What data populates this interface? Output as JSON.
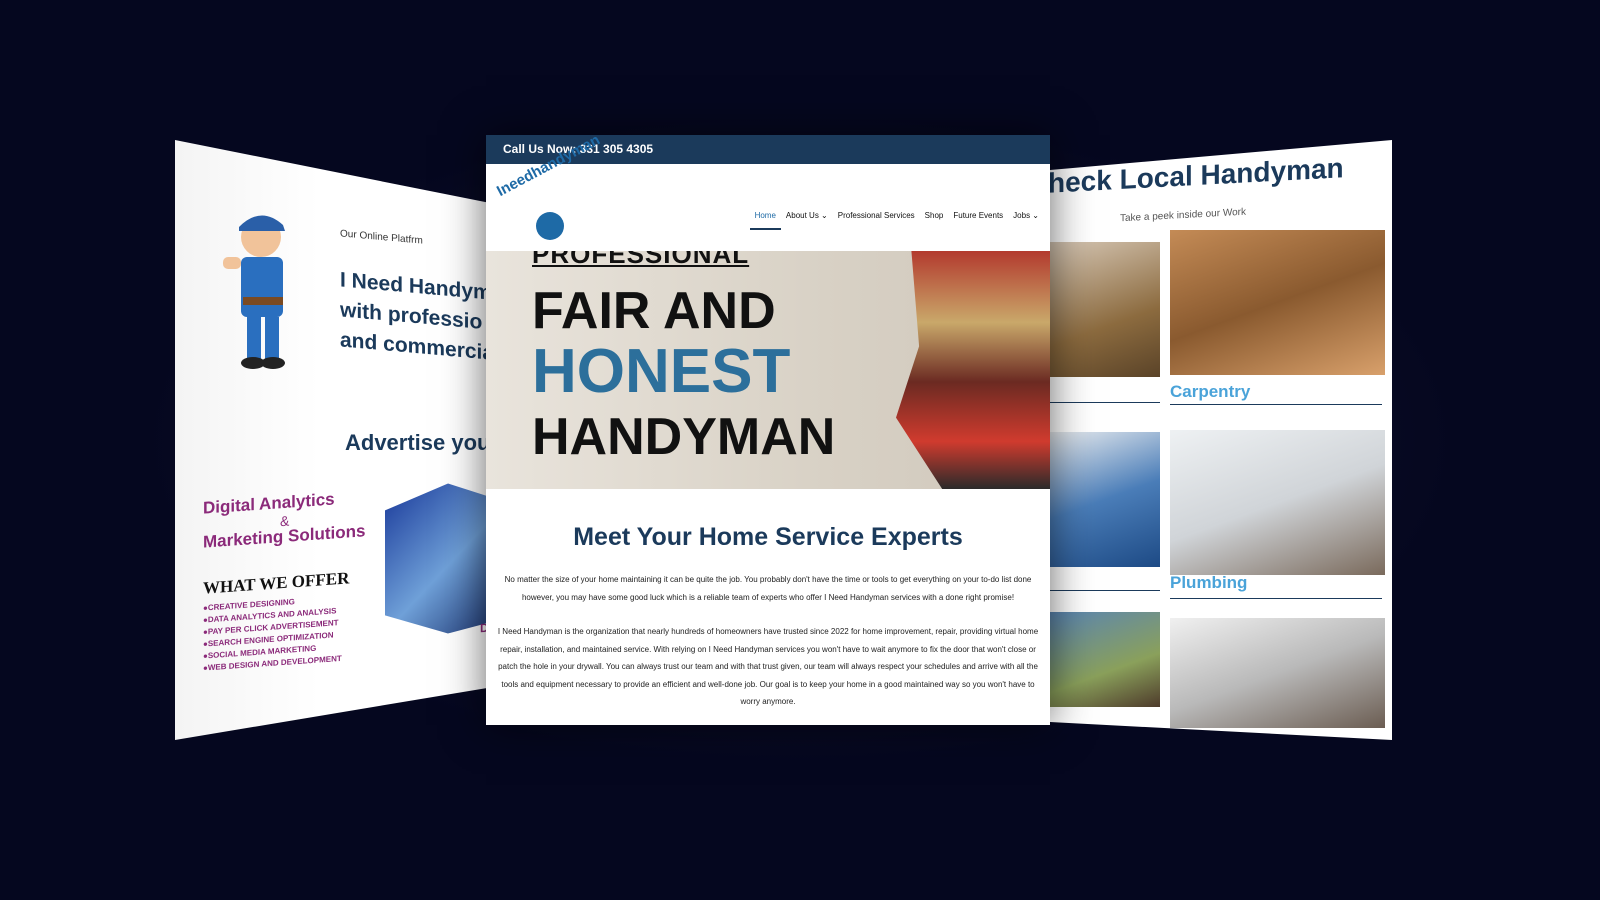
{
  "left_page": {
    "subtitle": "Our Online Platfrm",
    "heading_lines": [
      "I Need Handym",
      "with professio",
      "and commercia"
    ],
    "advertise": "Advertise your",
    "ad": {
      "title": "Digital Analytics",
      "amp": "&",
      "title2": "Marketing Solutions",
      "what": "WHAT WE OFFER",
      "items": [
        "CREATIVE DESIGNING",
        "DATA ANALYTICS AND ANALYSIS",
        "PAY PER CLICK ADVERTISEMENT",
        "SEARCH ENGINE OPTIMIZATION",
        "SOCIAL MEDIA MARKETING",
        "WEB DESIGN AND DEVELOPMENT"
      ],
      "logo": "DAA"
    }
  },
  "center_page": {
    "topbar": "Call Us Now: 331 305 4305",
    "logo": "Ineedhandyman",
    "nav": [
      {
        "label": "Home",
        "active": true
      },
      {
        "label": "About Us ⌄"
      },
      {
        "label": "Professional Services"
      },
      {
        "label": "Shop"
      },
      {
        "label": "Future Events"
      },
      {
        "label": "Jobs ⌄"
      }
    ],
    "hero": {
      "pre": "PROFESSIONAL",
      "line1": "FAIR AND",
      "line2": "HONEST",
      "line3": "HANDYMAN"
    },
    "heading": "Meet Your Home Service Experts",
    "paragraph1": "No matter the size of your home maintaining it can be quite the job. You probably don't have the time or tools to get everything on your to-do list done however, you may have some good luck which is a reliable team of experts who offer I Need Handyman services with a done right promise!",
    "paragraph2": "I Need Handyman is the organization that nearly hundreds of homeowners have trusted since 2022 for home improvement, repair, providing virtual home repair, installation, and maintained service. With relying on I Need Handyman services you won't have to wait anymore to fix the door that won't close or patch the hole in your drywall. You can always trust our team and with that trust given, our team will always respect your schedules and arrive with all the tools and equipment necessary to provide an efficient and well-done job. Our goal is to keep your home in a good maintained way so you won't have to worry anymore."
  },
  "right_page": {
    "heading": "heck Local Handyman",
    "subtitle": "Take a peek inside our Work",
    "labels": [
      "Carpentry",
      "Plumbing"
    ]
  },
  "colors": {
    "background": "#05071f",
    "navy": "#1b3a5b",
    "accent": "#4aa3d9"
  }
}
